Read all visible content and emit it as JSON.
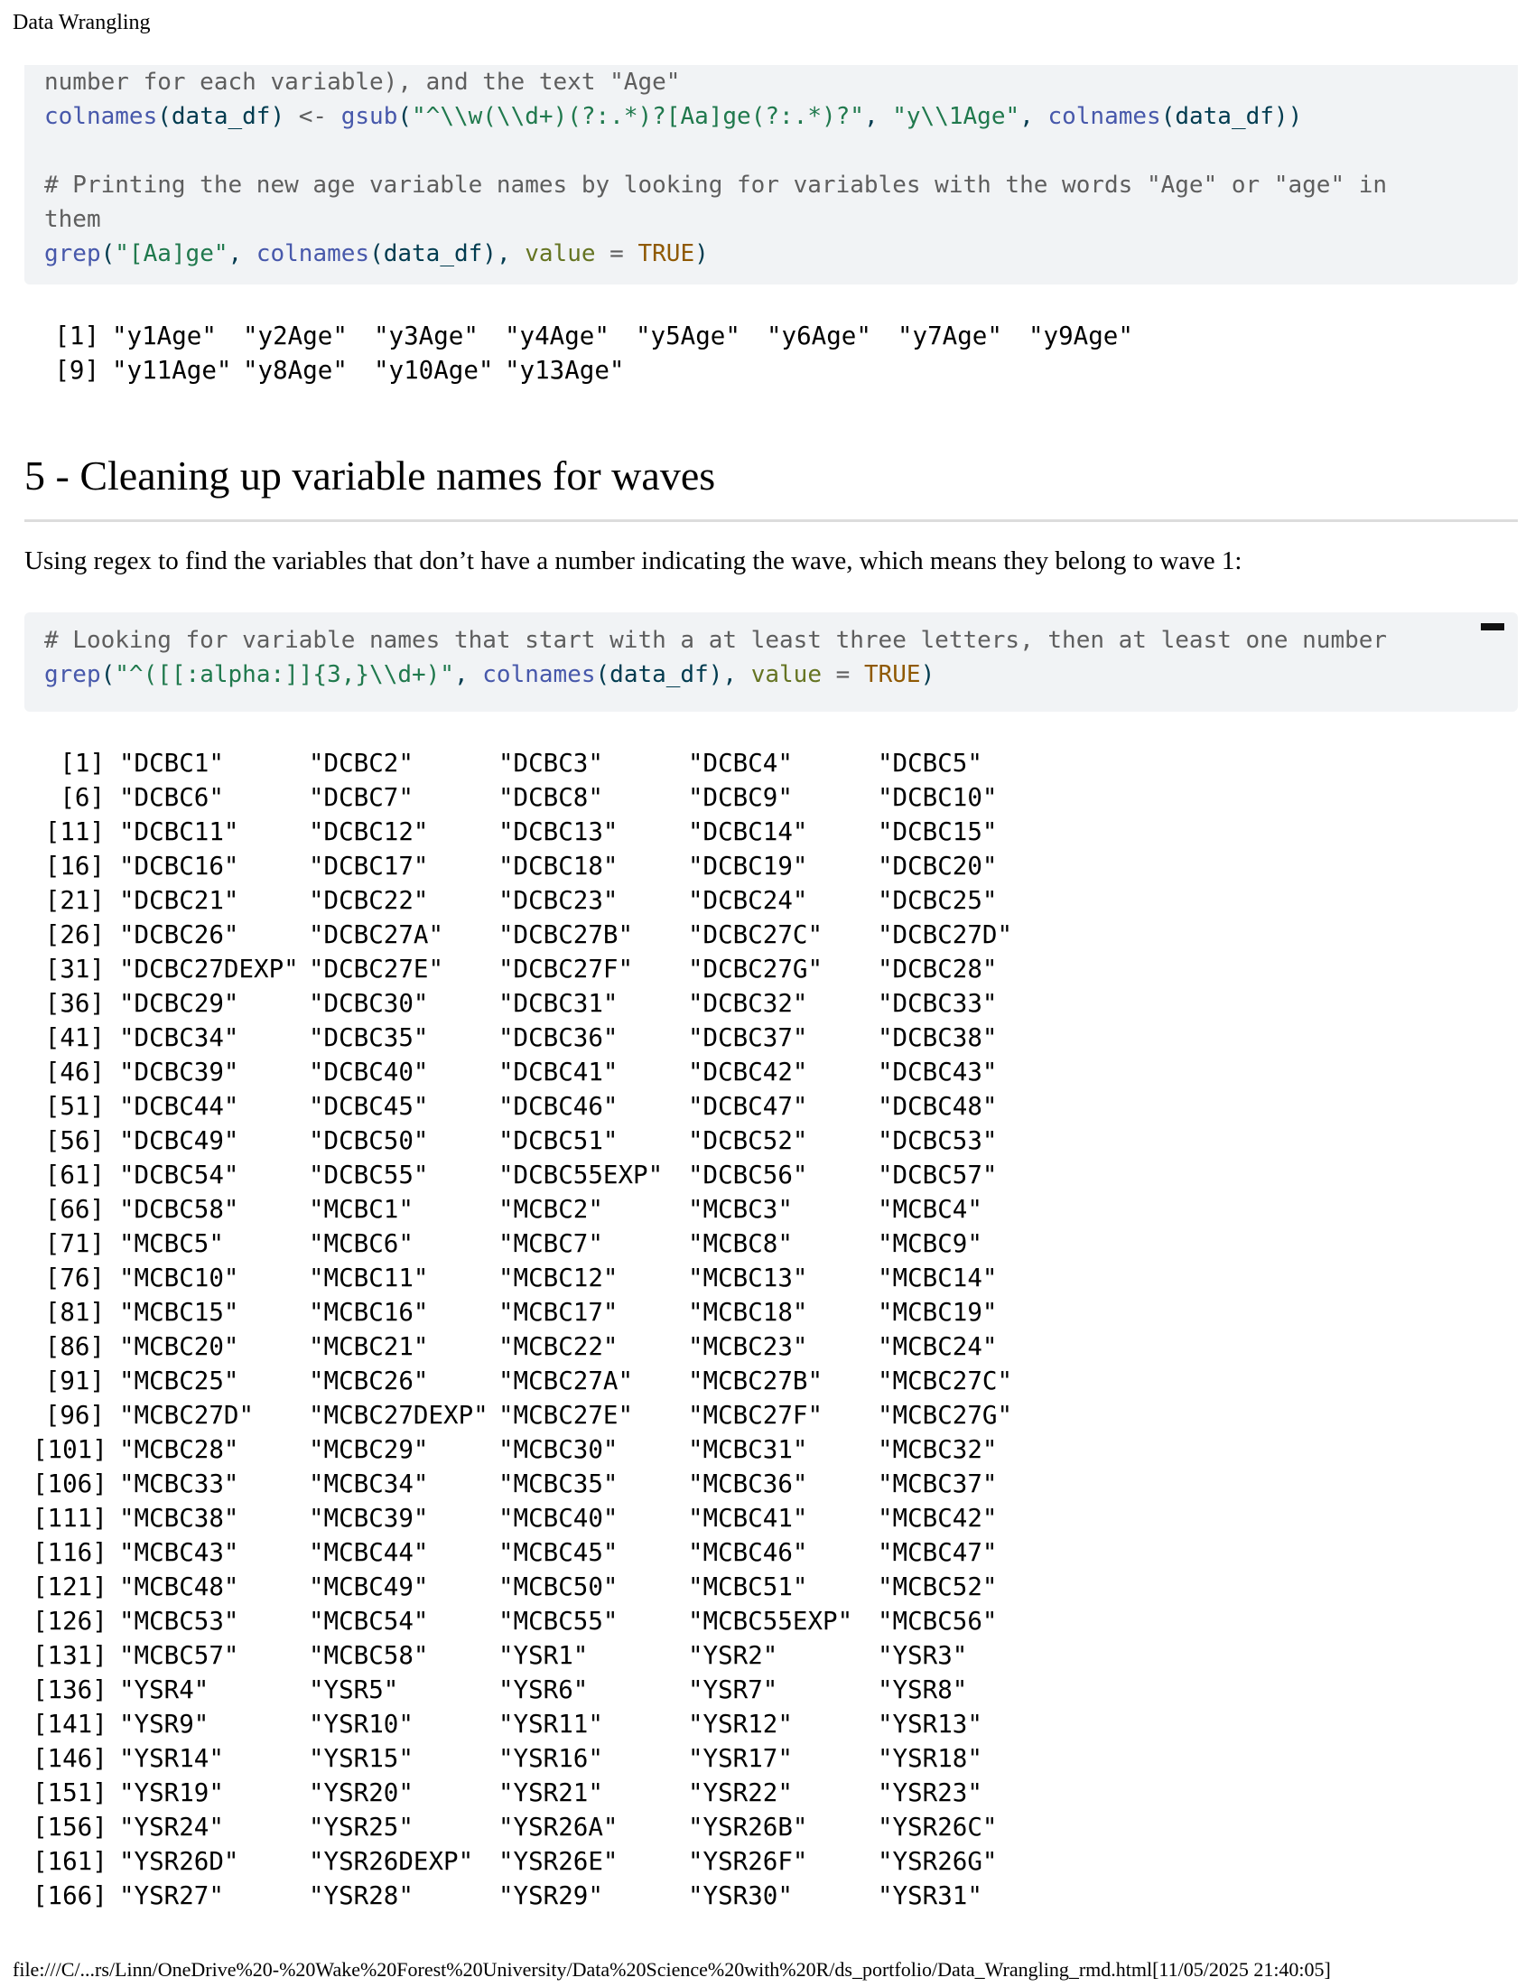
{
  "header": {
    "title": "Data Wrangling"
  },
  "code1": {
    "lines": [
      [
        {
          "t": "number for each variable), and the text \"Age\"",
          "c": "c-comment"
        }
      ],
      [
        {
          "t": "colnames",
          "c": "c-func"
        },
        {
          "t": "(data_df) ",
          "c": "c-plain"
        },
        {
          "t": "<-",
          "c": "c-op"
        },
        {
          "t": " ",
          "c": "c-plain"
        },
        {
          "t": "gsub",
          "c": "c-func"
        },
        {
          "t": "(",
          "c": "c-plain"
        },
        {
          "t": "\"^\\\\w(\\\\d+)(?:.*)?[Aa]ge(?:.*)?\"",
          "c": "c-string"
        },
        {
          "t": ", ",
          "c": "c-plain"
        },
        {
          "t": "\"y\\\\1Age\"",
          "c": "c-string"
        },
        {
          "t": ", ",
          "c": "c-plain"
        },
        {
          "t": "colnames",
          "c": "c-func"
        },
        {
          "t": "(data_df))",
          "c": "c-plain"
        }
      ],
      [
        {
          "t": "",
          "c": "c-plain"
        }
      ],
      [
        {
          "t": "# Printing the new age variable names by looking for variables with the words \"Age\" or \"age\" in",
          "c": "c-comment"
        }
      ],
      [
        {
          "t": "them",
          "c": "c-comment"
        }
      ],
      [
        {
          "t": "grep",
          "c": "c-func"
        },
        {
          "t": "(",
          "c": "c-plain"
        },
        {
          "t": "\"[Aa]ge\"",
          "c": "c-string"
        },
        {
          "t": ", ",
          "c": "c-plain"
        },
        {
          "t": "colnames",
          "c": "c-func"
        },
        {
          "t": "(data_df), ",
          "c": "c-plain"
        },
        {
          "t": "value",
          "c": "c-arg"
        },
        {
          "t": " = ",
          "c": "c-op"
        },
        {
          "t": "TRUE",
          "c": "c-const"
        },
        {
          "t": ")",
          "c": "c-plain"
        }
      ]
    ]
  },
  "output1": {
    "rows": [
      {
        "idx": "[1]",
        "items": [
          "\"y1Age\"",
          "\"y2Age\"",
          "\"y3Age\"",
          "\"y4Age\"",
          "\"y5Age\"",
          "\"y6Age\"",
          "\"y7Age\"",
          "\"y9Age\""
        ]
      },
      {
        "idx": "[9]",
        "items": [
          "\"y11Age\"",
          "\"y8Age\"",
          "\"y10Age\"",
          "\"y13Age\""
        ]
      }
    ]
  },
  "section": {
    "heading": "5 - Cleaning up variable names for waves",
    "paragraph": "Using regex to find the variables that don’t have a number indicating the wave, which means they belong to wave 1:"
  },
  "code2": {
    "lines": [
      [
        {
          "t": "# Looking for variable names that start with a at least three letters, then at least one number",
          "c": "c-comment"
        }
      ],
      [
        {
          "t": "grep",
          "c": "c-func"
        },
        {
          "t": "(",
          "c": "c-plain"
        },
        {
          "t": "\"^([[:alpha:]]{3,}\\\\d+)\"",
          "c": "c-string"
        },
        {
          "t": ", ",
          "c": "c-plain"
        },
        {
          "t": "colnames",
          "c": "c-func"
        },
        {
          "t": "(data_df), ",
          "c": "c-plain"
        },
        {
          "t": "value",
          "c": "c-arg"
        },
        {
          "t": " = ",
          "c": "c-op"
        },
        {
          "t": "TRUE",
          "c": "c-const"
        },
        {
          "t": ")",
          "c": "c-plain"
        }
      ]
    ]
  },
  "output2": {
    "rows": [
      {
        "idx": "[1]",
        "items": [
          "\"DCBC1\"",
          "\"DCBC2\"",
          "\"DCBC3\"",
          "\"DCBC4\"",
          "\"DCBC5\""
        ]
      },
      {
        "idx": "[6]",
        "items": [
          "\"DCBC6\"",
          "\"DCBC7\"",
          "\"DCBC8\"",
          "\"DCBC9\"",
          "\"DCBC10\""
        ]
      },
      {
        "idx": "[11]",
        "items": [
          "\"DCBC11\"",
          "\"DCBC12\"",
          "\"DCBC13\"",
          "\"DCBC14\"",
          "\"DCBC15\""
        ]
      },
      {
        "idx": "[16]",
        "items": [
          "\"DCBC16\"",
          "\"DCBC17\"",
          "\"DCBC18\"",
          "\"DCBC19\"",
          "\"DCBC20\""
        ]
      },
      {
        "idx": "[21]",
        "items": [
          "\"DCBC21\"",
          "\"DCBC22\"",
          "\"DCBC23\"",
          "\"DCBC24\"",
          "\"DCBC25\""
        ]
      },
      {
        "idx": "[26]",
        "items": [
          "\"DCBC26\"",
          "\"DCBC27A\"",
          "\"DCBC27B\"",
          "\"DCBC27C\"",
          "\"DCBC27D\""
        ]
      },
      {
        "idx": "[31]",
        "items": [
          "\"DCBC27DEXP\"",
          "\"DCBC27E\"",
          "\"DCBC27F\"",
          "\"DCBC27G\"",
          "\"DCBC28\""
        ]
      },
      {
        "idx": "[36]",
        "items": [
          "\"DCBC29\"",
          "\"DCBC30\"",
          "\"DCBC31\"",
          "\"DCBC32\"",
          "\"DCBC33\""
        ]
      },
      {
        "idx": "[41]",
        "items": [
          "\"DCBC34\"",
          "\"DCBC35\"",
          "\"DCBC36\"",
          "\"DCBC37\"",
          "\"DCBC38\""
        ]
      },
      {
        "idx": "[46]",
        "items": [
          "\"DCBC39\"",
          "\"DCBC40\"",
          "\"DCBC41\"",
          "\"DCBC42\"",
          "\"DCBC43\""
        ]
      },
      {
        "idx": "[51]",
        "items": [
          "\"DCBC44\"",
          "\"DCBC45\"",
          "\"DCBC46\"",
          "\"DCBC47\"",
          "\"DCBC48\""
        ]
      },
      {
        "idx": "[56]",
        "items": [
          "\"DCBC49\"",
          "\"DCBC50\"",
          "\"DCBC51\"",
          "\"DCBC52\"",
          "\"DCBC53\""
        ]
      },
      {
        "idx": "[61]",
        "items": [
          "\"DCBC54\"",
          "\"DCBC55\"",
          "\"DCBC55EXP\"",
          "\"DCBC56\"",
          "\"DCBC57\""
        ]
      },
      {
        "idx": "[66]",
        "items": [
          "\"DCBC58\"",
          "\"MCBC1\"",
          "\"MCBC2\"",
          "\"MCBC3\"",
          "\"MCBC4\""
        ]
      },
      {
        "idx": "[71]",
        "items": [
          "\"MCBC5\"",
          "\"MCBC6\"",
          "\"MCBC7\"",
          "\"MCBC8\"",
          "\"MCBC9\""
        ]
      },
      {
        "idx": "[76]",
        "items": [
          "\"MCBC10\"",
          "\"MCBC11\"",
          "\"MCBC12\"",
          "\"MCBC13\"",
          "\"MCBC14\""
        ]
      },
      {
        "idx": "[81]",
        "items": [
          "\"MCBC15\"",
          "\"MCBC16\"",
          "\"MCBC17\"",
          "\"MCBC18\"",
          "\"MCBC19\""
        ]
      },
      {
        "idx": "[86]",
        "items": [
          "\"MCBC20\"",
          "\"MCBC21\"",
          "\"MCBC22\"",
          "\"MCBC23\"",
          "\"MCBC24\""
        ]
      },
      {
        "idx": "[91]",
        "items": [
          "\"MCBC25\"",
          "\"MCBC26\"",
          "\"MCBC27A\"",
          "\"MCBC27B\"",
          "\"MCBC27C\""
        ]
      },
      {
        "idx": "[96]",
        "items": [
          "\"MCBC27D\"",
          "\"MCBC27DEXP\"",
          "\"MCBC27E\"",
          "\"MCBC27F\"",
          "\"MCBC27G\""
        ]
      },
      {
        "idx": "[101]",
        "items": [
          "\"MCBC28\"",
          "\"MCBC29\"",
          "\"MCBC30\"",
          "\"MCBC31\"",
          "\"MCBC32\""
        ]
      },
      {
        "idx": "[106]",
        "items": [
          "\"MCBC33\"",
          "\"MCBC34\"",
          "\"MCBC35\"",
          "\"MCBC36\"",
          "\"MCBC37\""
        ]
      },
      {
        "idx": "[111]",
        "items": [
          "\"MCBC38\"",
          "\"MCBC39\"",
          "\"MCBC40\"",
          "\"MCBC41\"",
          "\"MCBC42\""
        ]
      },
      {
        "idx": "[116]",
        "items": [
          "\"MCBC43\"",
          "\"MCBC44\"",
          "\"MCBC45\"",
          "\"MCBC46\"",
          "\"MCBC47\""
        ]
      },
      {
        "idx": "[121]",
        "items": [
          "\"MCBC48\"",
          "\"MCBC49\"",
          "\"MCBC50\"",
          "\"MCBC51\"",
          "\"MCBC52\""
        ]
      },
      {
        "idx": "[126]",
        "items": [
          "\"MCBC53\"",
          "\"MCBC54\"",
          "\"MCBC55\"",
          "\"MCBC55EXP\"",
          "\"MCBC56\""
        ]
      },
      {
        "idx": "[131]",
        "items": [
          "\"MCBC57\"",
          "\"MCBC58\"",
          "\"YSR1\"",
          "\"YSR2\"",
          "\"YSR3\""
        ]
      },
      {
        "idx": "[136]",
        "items": [
          "\"YSR4\"",
          "\"YSR5\"",
          "\"YSR6\"",
          "\"YSR7\"",
          "\"YSR8\""
        ]
      },
      {
        "idx": "[141]",
        "items": [
          "\"YSR9\"",
          "\"YSR10\"",
          "\"YSR11\"",
          "\"YSR12\"",
          "\"YSR13\""
        ]
      },
      {
        "idx": "[146]",
        "items": [
          "\"YSR14\"",
          "\"YSR15\"",
          "\"YSR16\"",
          "\"YSR17\"",
          "\"YSR18\""
        ]
      },
      {
        "idx": "[151]",
        "items": [
          "\"YSR19\"",
          "\"YSR20\"",
          "\"YSR21\"",
          "\"YSR22\"",
          "\"YSR23\""
        ]
      },
      {
        "idx": "[156]",
        "items": [
          "\"YSR24\"",
          "\"YSR25\"",
          "\"YSR26A\"",
          "\"YSR26B\"",
          "\"YSR26C\""
        ]
      },
      {
        "idx": "[161]",
        "items": [
          "\"YSR26D\"",
          "\"YSR26DEXP\"",
          "\"YSR26E\"",
          "\"YSR26F\"",
          "\"YSR26G\""
        ]
      },
      {
        "idx": "[166]",
        "items": [
          "\"YSR27\"",
          "\"YSR28\"",
          "\"YSR29\"",
          "\"YSR30\"",
          "\"YSR31\""
        ]
      }
    ]
  },
  "footer": {
    "path": "file:///C/...rs/Linn/OneDrive%20-%20Wake%20Forest%20University/Data%20Science%20with%20R/ds_portfolio/Data_Wrangling_rmd.html[11/05/2025 21:40:05]"
  }
}
